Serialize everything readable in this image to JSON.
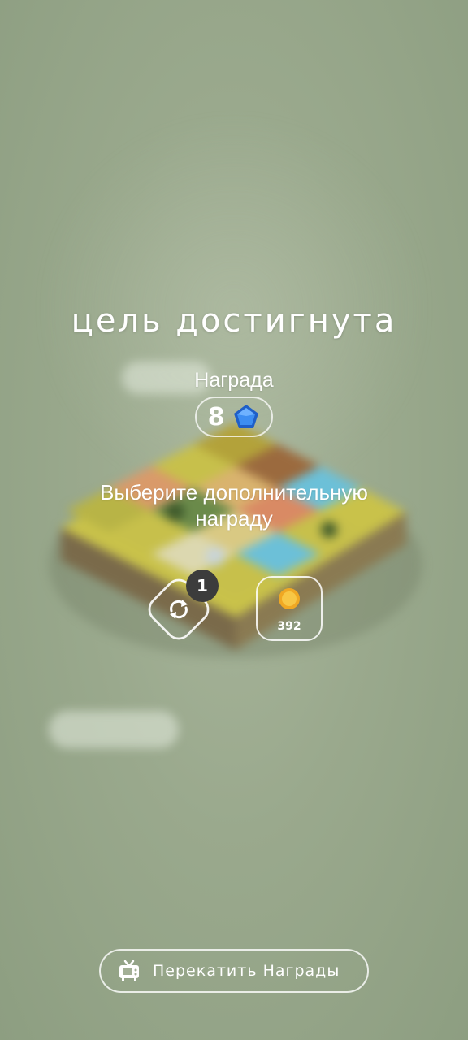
{
  "title": "цель достигнута",
  "reward": {
    "label": "Награда",
    "amount": "8",
    "icon": "blue-gem-icon"
  },
  "choose": {
    "line1": "Выберите дополнительную",
    "line2": "награду"
  },
  "options": {
    "reroll": {
      "icon": "refresh-icon",
      "badge": "1"
    },
    "coins": {
      "icon": "coin-icon",
      "count": "392"
    }
  },
  "footer": {
    "button_label": "Перекатить Награды",
    "icon": "tv-icon"
  },
  "colors": {
    "background": "#9aa98d",
    "gem": "#2f7fe8",
    "coin": "#f5b82e",
    "badge": "#3c3c3c"
  }
}
